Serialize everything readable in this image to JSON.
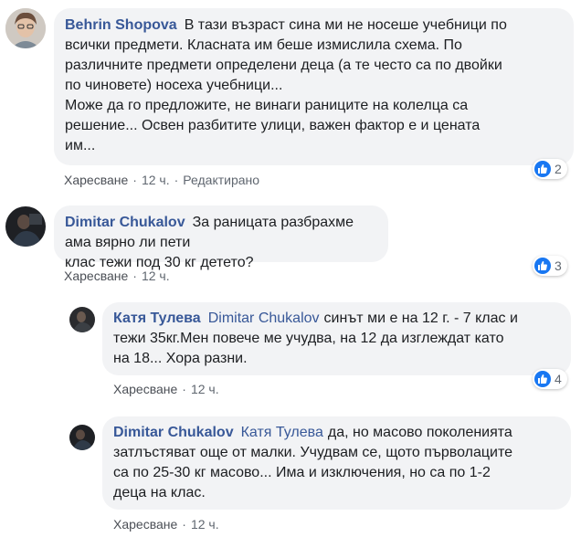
{
  "colors": {
    "author": "#385898",
    "bubble": "#f2f3f5",
    "like_badge": "#1877f2",
    "meta_text": "#606770"
  },
  "comments": [
    {
      "author": "Behrin Shopova",
      "lines": [
        "В тази възраст сина ми не носеше учебници по",
        "всички предмети. Класната им беше измислила схема. По",
        "различните предмети определени деца (а те често са по двойки",
        "по чиновете) носеха учебници...",
        "Може да го предложите, не винаги раниците на колелца са",
        "решение... Освен разбитите улици, важен фактор е и цената",
        "им..."
      ],
      "like_label": "Харесване",
      "time": "12 ч.",
      "edited": "Редактирано",
      "reactions": "2",
      "avatar_icon": "woman-with-glasses-avatar"
    },
    {
      "author": "Dimitar Chukalov",
      "lines": [
        "За раницата разбрахме ама вярно ли пети",
        "клас тежи под 30 кг детето?"
      ],
      "like_label": "Харесване",
      "time": "12 ч.",
      "reactions": "3",
      "avatar_icon": "dark-photo-avatar"
    },
    {
      "author": "Катя Тулева",
      "mention": "Dimitar Chukalov",
      "lines": [
        "синът ми е на 12 г. - 7 клас и",
        "тежи 35кг.Мен повече ме учудва, на 12 да изглеждат като",
        "на 18... Хора разни."
      ],
      "like_label": "Харесване",
      "time": "12 ч.",
      "reactions": "4",
      "avatar_icon": "dark-photo-avatar"
    },
    {
      "author": "Dimitar Chukalov",
      "mention": "Катя Тулева",
      "lines": [
        "да, но масово поколенията",
        "затлъстяват още от малки. Учудвам се, щото първолаците",
        "са по 25-30 кг масово... Има и изключения, но са по 1-2",
        "деца на клас."
      ],
      "like_label": "Харесване",
      "time": "12 ч.",
      "avatar_icon": "dark-photo-avatar"
    }
  ]
}
